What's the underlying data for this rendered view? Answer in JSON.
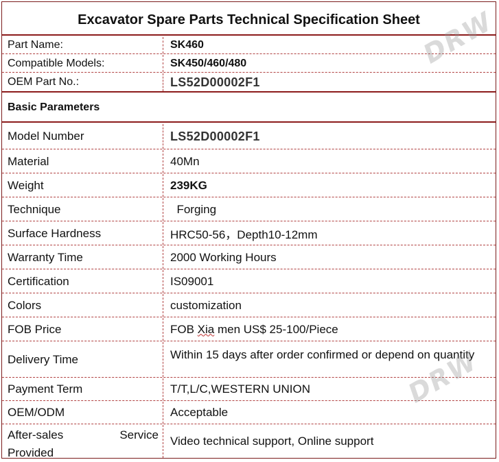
{
  "title": "Excavator Spare Parts Technical Specification Sheet",
  "header_rows": [
    {
      "label": "Part Name:",
      "value": "SK460"
    },
    {
      "label": "Compatible Models:",
      "value": "SK450/460/480"
    },
    {
      "label": "OEM Part No.:",
      "value": "LS52D00002F1"
    }
  ],
  "section_title": "Basic Parameters",
  "params": [
    {
      "label": "Model Number",
      "value": "LS52D00002F1"
    },
    {
      "label": "Material",
      "value": "40Mn"
    },
    {
      "label": "Weight",
      "value": "239KG"
    },
    {
      "label": "Technique",
      "value": "  Forging"
    },
    {
      "label": "Surface Hardness",
      "value": "HRC50-56，Depth10-12mm"
    },
    {
      "label": "Warranty Time",
      "value": "2000 Working Hours"
    },
    {
      "label": "Certification",
      "value": "IS09001"
    },
    {
      "label": "Colors",
      "value": "customization"
    },
    {
      "label": "FOB Price",
      "value_pre": "FOB ",
      "value_mid": "Xia",
      "value_post": " men US$ 25-100/Piece"
    },
    {
      "label": "Delivery Time",
      "value": "Within 15 days after order confirmed or depend on quantity"
    },
    {
      "label": "Payment Term",
      "value": "T/T,L/C,WESTERN UNION"
    },
    {
      "label": "OEM/ODM",
      "value": "Acceptable"
    },
    {
      "label_a": "After-sales",
      "label_b": "Service",
      "label_c": "Provided",
      "value": "Video technical support, Online support"
    }
  ],
  "watermark": "DRW"
}
